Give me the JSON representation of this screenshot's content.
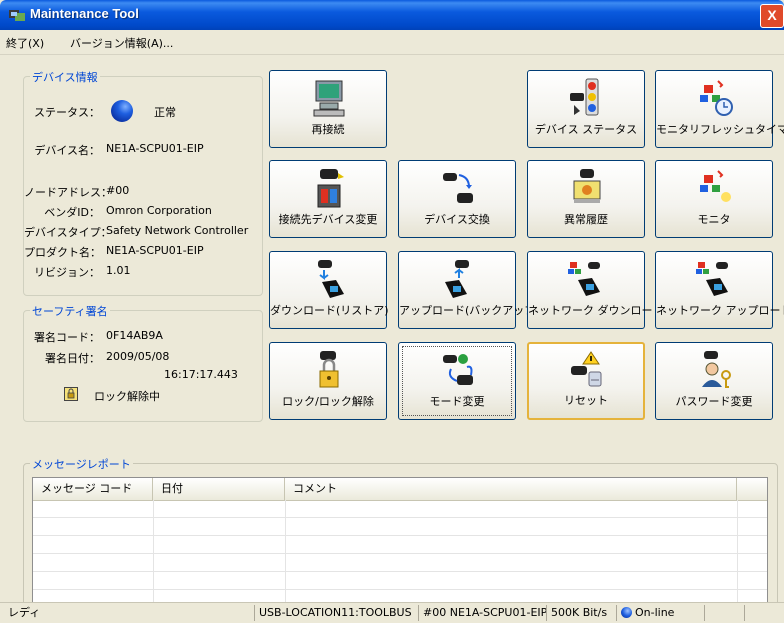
{
  "window": {
    "title": "Maintenance Tool",
    "close_glyph": "X"
  },
  "menu": {
    "exit": "終了(X)",
    "version": "バージョン情報(A)..."
  },
  "device_info": {
    "legend": "デバイス情報",
    "status_label": "ステータス：",
    "status_value": "正常",
    "status_color": "#1e5fe0",
    "device_name_label": "デバイス名：",
    "device_name": "NE1A-SCPU01-EIP",
    "node_address_label": "ノードアドレス：",
    "node_address": "#00",
    "vendor_id_label": "ベンダID：",
    "vendor_id": "Omron Corporation",
    "device_type_label": "デバイスタイプ：",
    "device_type": "Safety Network Controller",
    "product_name_label": "プロダクト名：",
    "product_name": "NE1A-SCPU01-EIP",
    "revision_label": "リビジョン：",
    "revision": "1.01"
  },
  "safety_signature": {
    "legend": "セーフティ署名",
    "code_label": "署名コード：",
    "code": "0F14AB9A",
    "date_label": "署名日付：",
    "date": "2009/05/08",
    "time": "16:17:17.443",
    "lock_status": "ロック解除中",
    "lock_icon": "lock-icon"
  },
  "buttons": [
    {
      "label": "再接続",
      "icon": "computer-icon"
    },
    {
      "label": "デバイス ステータス",
      "icon": "traffic-light-icon"
    },
    {
      "label": "モニタリフレッシュタイマ設定",
      "icon": "timer-icon"
    },
    {
      "label": "接続先デバイス変更",
      "icon": "device-switch-icon"
    },
    {
      "label": "デバイス交換",
      "icon": "device-replace-icon"
    },
    {
      "label": "異常履歴",
      "icon": "error-history-icon"
    },
    {
      "label": "モニタ",
      "icon": "monitor-icon"
    },
    {
      "label": "ダウンロード(リストア)",
      "icon": "download-icon"
    },
    {
      "label": "アップロード(バックアップ)",
      "icon": "upload-icon"
    },
    {
      "label": "ネットワーク ダウンロード",
      "icon": "network-download-icon"
    },
    {
      "label": "ネットワーク アップロード",
      "icon": "network-upload-icon"
    },
    {
      "label": "ロック/ロック解除",
      "icon": "lock-icon"
    },
    {
      "label": "モード変更",
      "icon": "mode-change-icon"
    },
    {
      "label": "リセット",
      "icon": "reset-icon"
    },
    {
      "label": "パスワード変更",
      "icon": "password-icon"
    }
  ],
  "message_report": {
    "legend": "メッセージレポート",
    "columns": [
      "メッセージ コード",
      "日付",
      "コメント"
    ],
    "rows": []
  },
  "statusbar": {
    "ready": "レディ",
    "location": "USB-LOCATION11:TOOLBUS",
    "device": "#00 NE1A-SCPU01-EIP",
    "baud": "500K Bit/s",
    "online": "On-line",
    "online_color": "#1e5fe0"
  }
}
